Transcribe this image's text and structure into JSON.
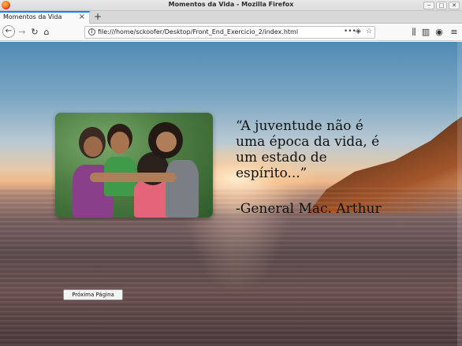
{
  "window": {
    "title": "Momentos da Vida - Mozilla Firefox",
    "controls": [
      "−",
      "□",
      "✕"
    ]
  },
  "tabs": [
    {
      "label": "Momentos da Vida",
      "close": "×"
    }
  ],
  "new_tab_label": "+",
  "nav": {
    "back": "←",
    "forward": "→",
    "reload": "↻",
    "home": "⌂",
    "url": "file:///home/sckoofer/Desktop/Front_End_Exercicio_2/index.html",
    "page_actions": "•••",
    "pocket": "◈",
    "bookmark": "☆",
    "library": "⫼",
    "sidebar": "▥",
    "account": "◉",
    "menu": "≡"
  },
  "page": {
    "quote": "“A juventude não é uma época da vida, é um estado de espírito...”",
    "author": "-General Mac. Arthur",
    "next_button": "Próxima Página"
  },
  "icons": {
    "firefox": "firefox-logo-icon",
    "info": "info-icon"
  }
}
